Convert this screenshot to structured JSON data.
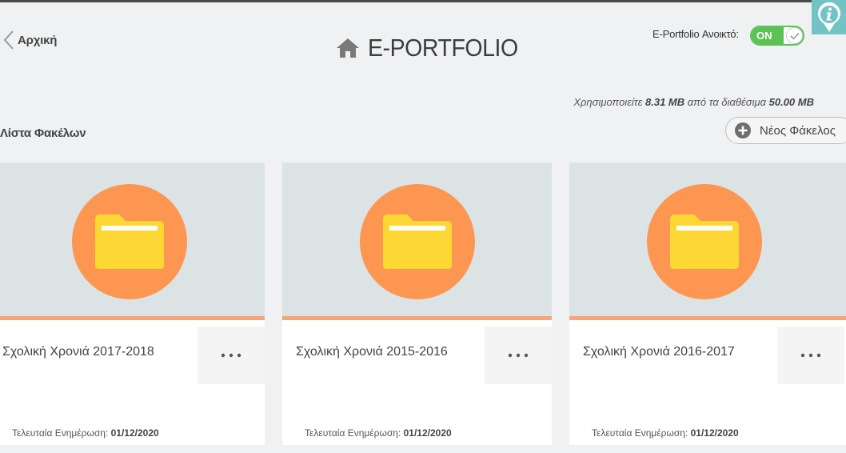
{
  "header": {
    "back_label": "Αρχική",
    "title": "E-PORTFOLIO",
    "open_label": "E-Portfolio Ανοικτό:",
    "toggle_state": "ON"
  },
  "storage": {
    "prefix": "Χρησιμοποιείτε",
    "used": "8.31 MB",
    "middle": "από τα διαθέσιμα",
    "total": "50.00 MB"
  },
  "list": {
    "title": "Λίστα Φακέλων",
    "new_folder_label": "Νέος Φάκελος"
  },
  "folders": [
    {
      "title": "Σχολική Χρονιά 2017-2018",
      "updated_label": "Τελευταία Ενημέρωση:",
      "updated_date": "01/12/2020"
    },
    {
      "title": "Σχολική Χρονιά 2015-2016",
      "updated_label": "Τελευταία Ενημέρωση:",
      "updated_date": "01/12/2020"
    },
    {
      "title": "Σχολική Χρονιά 2016-2017",
      "updated_label": "Τελευταία Ενημέρωση:",
      "updated_date": "01/12/2020"
    }
  ],
  "colors": {
    "accent_green": "#5cc255",
    "folder_circle": "#fd9650",
    "folder_yellow": "#fdd835",
    "card_media_bg": "#dbe3e5",
    "card_stripe": "#f4a67a",
    "info_badge": "#72c4c4"
  },
  "icons": {
    "back": "chevron-left-icon",
    "home": "home-icon",
    "toggle": "check-icon",
    "info": "info-icon",
    "new_folder": "plus-circle-icon",
    "folder": "folder-icon",
    "menu": "more-horizontal-icon"
  }
}
